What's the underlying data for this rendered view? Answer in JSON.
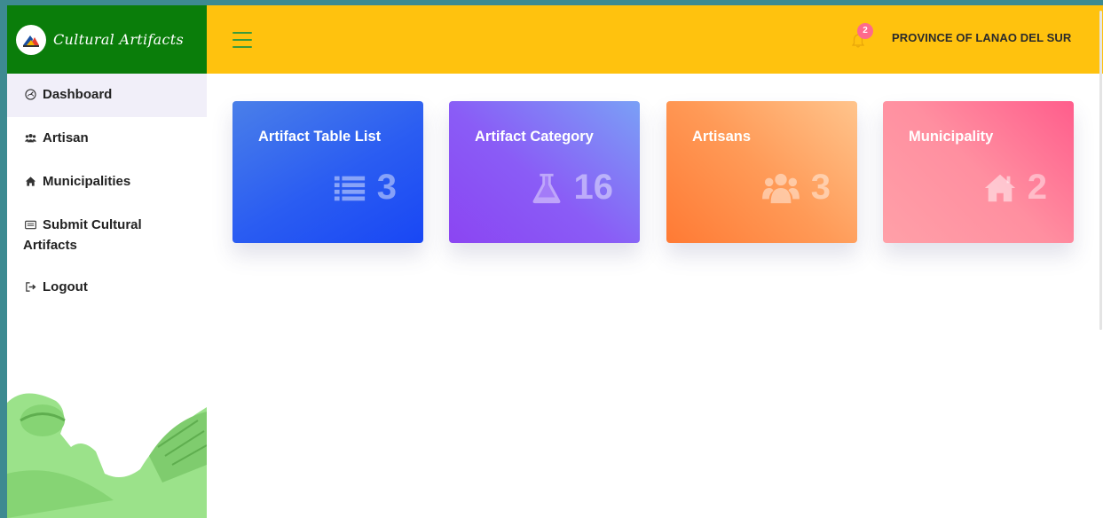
{
  "brand": {
    "name": "Cultural Artifacts"
  },
  "sidebar": {
    "items": [
      {
        "label": "Dashboard",
        "icon": "dashboard-icon",
        "active": true
      },
      {
        "label": "Artisan",
        "icon": "users-icon"
      },
      {
        "label": "Municipalities",
        "icon": "home-icon"
      },
      {
        "label": "Submit Cultural Artifacts",
        "icon": "keyboard-icon"
      },
      {
        "label": "Logout",
        "icon": "sign-out-icon"
      }
    ]
  },
  "topbar": {
    "menu_icon": "hamburger-icon",
    "notification_count": "2",
    "province": "PROVINCE OF LANAO DEL SUR"
  },
  "cards": [
    {
      "title": "Artifact Table List",
      "value": "3",
      "icon": "list-icon"
    },
    {
      "title": "Artifact Category",
      "value": "16",
      "icon": "flask-icon"
    },
    {
      "title": "Artisans",
      "value": "3",
      "icon": "users-icon"
    },
    {
      "title": "Municipality",
      "value": "2",
      "icon": "home-icon"
    }
  ],
  "colors": {
    "brand_green": "#0a7d0a",
    "topbar_yellow": "#ffc20e",
    "card_blue": "#2a5cf2",
    "card_purple": "#8a5cf6",
    "card_orange": "#ff9a57",
    "card_pink": "#ff7d96"
  }
}
